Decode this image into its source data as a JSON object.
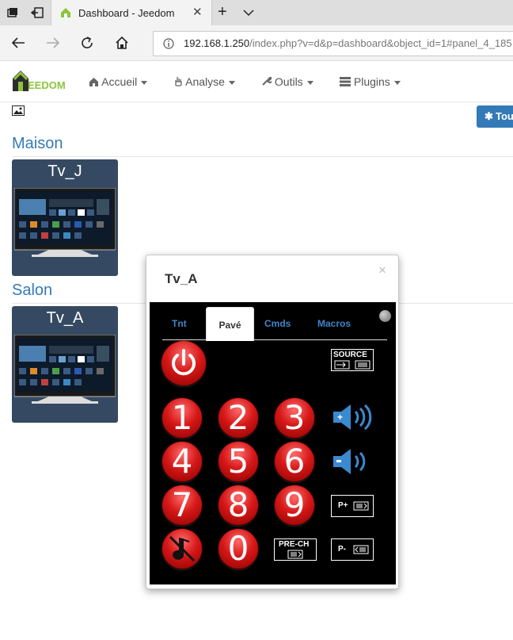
{
  "browser": {
    "tab_title": "Dashboard - Jeedom",
    "url_host": "192.168.1.250",
    "url_path": "/index.php?v=d&p=dashboard&object_id=1#panel_4_185"
  },
  "app": {
    "logo_text": "EEDOM",
    "menu": [
      {
        "label": "Accueil",
        "icon": "home-icon"
      },
      {
        "label": "Analyse",
        "icon": "hand-icon"
      },
      {
        "label": "Outils",
        "icon": "wrench-icon"
      },
      {
        "label": "Plugins",
        "icon": "tasks-icon"
      }
    ],
    "tous_button": "Tou"
  },
  "sections": [
    {
      "title": "Maison",
      "widget_name": "Tv_J"
    },
    {
      "title": "Salon",
      "widget_name": "Tv_A"
    }
  ],
  "modal": {
    "title": "Tv_A",
    "close": "×",
    "tabs": [
      {
        "label": "Tnt",
        "active": false
      },
      {
        "label": "Pavé",
        "active": true
      },
      {
        "label": "Cmds",
        "active": false
      },
      {
        "label": "Macros",
        "active": false
      }
    ],
    "digits": [
      "1",
      "2",
      "3",
      "4",
      "5",
      "6",
      "7",
      "8",
      "9",
      "0"
    ],
    "source_label": "SOURCE",
    "prech_label": "PRE-CH",
    "pplus_label": "P+",
    "pminus_label": "P-"
  },
  "colors": {
    "accent": "#337ab7",
    "widget_bg": "#354a62",
    "remote_button": "#d61818",
    "tab_blue": "#3f85c9"
  }
}
